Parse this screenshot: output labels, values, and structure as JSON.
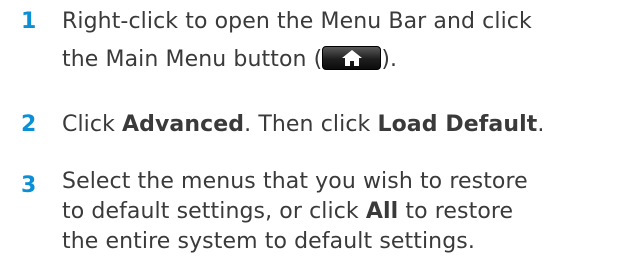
{
  "accent_color": "#0d8fd6",
  "steps": [
    {
      "number": "1",
      "line1": "Right-click to open the Menu Bar and click",
      "line2_before": "the Main Menu button (",
      "line2_after": ").",
      "button_icon": "home-icon"
    },
    {
      "number": "2",
      "t1": "Click ",
      "b1": "Advanced",
      "t2": ". Then click ",
      "b2": "Load Default",
      "t3": "."
    },
    {
      "number": "3",
      "line1": "Select the menus that you wish to restore",
      "line2_before": "to default settings, or click ",
      "line2_bold": "All",
      "line2_after": " to restore",
      "line3": "the entire system to default settings."
    }
  ]
}
